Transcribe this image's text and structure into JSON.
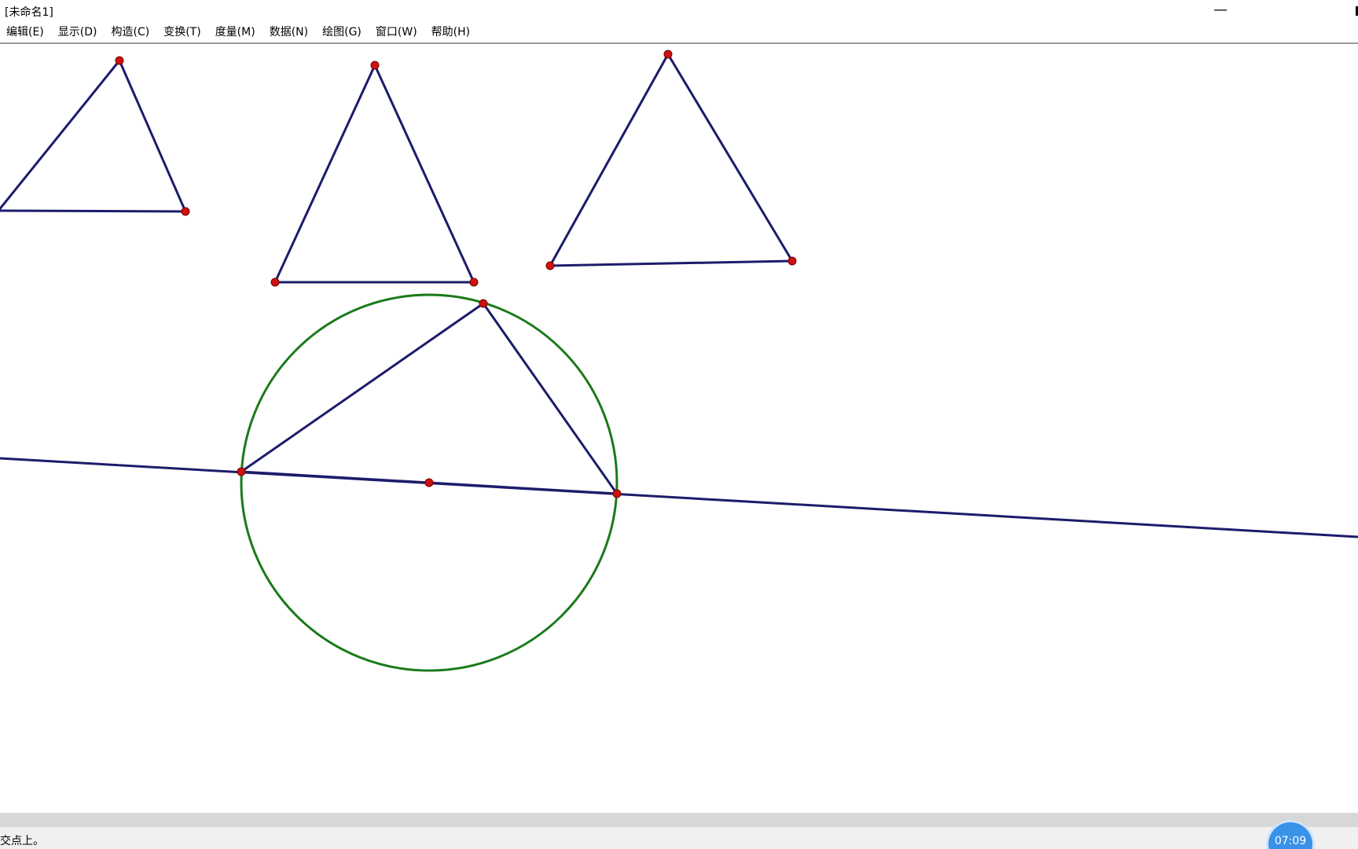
{
  "window": {
    "title": "[未命名1]",
    "minimize_glyph": "—"
  },
  "menu": {
    "items": [
      {
        "label": "编辑(E)"
      },
      {
        "label": "显示(D)"
      },
      {
        "label": "构造(C)"
      },
      {
        "label": "变换(T)"
      },
      {
        "label": "度量(M)"
      },
      {
        "label": "数据(N)"
      },
      {
        "label": "绘图(G)"
      },
      {
        "label": "窗口(W)"
      },
      {
        "label": "帮助(H)"
      }
    ]
  },
  "status": {
    "text": "交点上。"
  },
  "timer": {
    "text": "07:09"
  },
  "colors": {
    "segment": "#1c1c6b",
    "point": "#cc1111",
    "circle": "#1a7a1a",
    "timer": "#3a92e8"
  },
  "geometry": {
    "objects": [
      "triangle-1",
      "triangle-2",
      "triangle-3",
      "circle",
      "line",
      "inscribed-triangle",
      "center-point"
    ]
  }
}
